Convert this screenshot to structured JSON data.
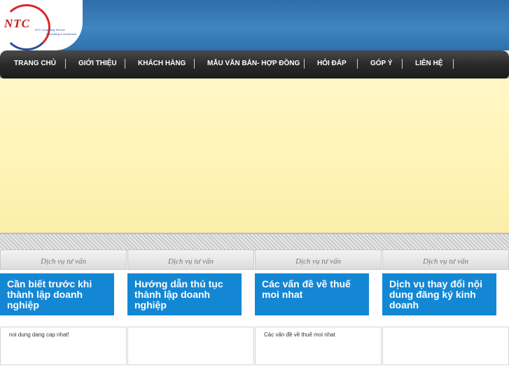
{
  "logo": {
    "text": "NTC",
    "sub1": "NTC Consulting Service",
    "sub2": "Consulting & Investment"
  },
  "nav": {
    "items": [
      "TRANG CHỦ",
      "GIỚI THIỆU",
      "KHÁCH HÀNG",
      "MẪU VĂN BẢN- HỢP ĐỒNG",
      "HỎI ĐÁP",
      "GÓP Ý",
      "LIÊN HỆ"
    ]
  },
  "columns": [
    {
      "header": "Dịch vụ tư vấn",
      "title": "Cần biết trước khi thành lập doanh nghiệp",
      "body": "noi dung dang cap nhat!"
    },
    {
      "header": "Dịch vụ tư vấn",
      "title": "Hướng dẫn thủ tục thành lập doanh nghiệp",
      "body": ""
    },
    {
      "header": "Dịch vụ tư vấn",
      "title": "Các vấn đề về thuế moi nhat",
      "body": "Các vấn đề về thuế moi nhat"
    },
    {
      "header": "Dịch vụ tư vấn",
      "title": "Dịch vụ thay đổi nội dung đăng ký kinh doanh",
      "body": ""
    }
  ]
}
